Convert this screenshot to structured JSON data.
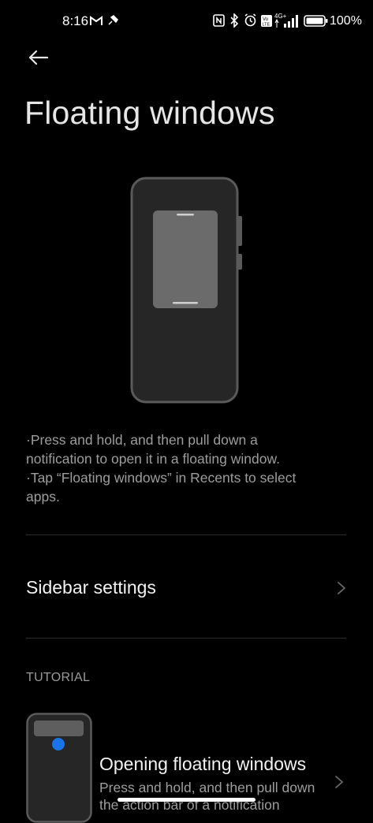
{
  "status_bar": {
    "time": "8:16",
    "battery_percent": "100%",
    "icons": [
      "gmail-icon",
      "pin-icon",
      "nfc-icon",
      "bluetooth-icon",
      "alarm-icon",
      "volte-icon",
      "signal-4g-icon",
      "battery-icon"
    ],
    "network_label": "4G+"
  },
  "header": {
    "back_icon": "arrow-left-icon",
    "title": "Floating windows"
  },
  "description": {
    "line1": "·Press and hold, and then pull down a",
    "line2": "notification to open it in a floating window.",
    "line3": "·Tap “Floating windows” in Recents to select",
    "line4": "apps."
  },
  "settings": {
    "sidebar_label": "Sidebar settings"
  },
  "tutorial": {
    "section_label": "TUTORIAL",
    "items": [
      {
        "title": "Opening floating windows",
        "desc_line1": "Press and hold, and then pull down",
        "desc_line2": "the action bar of a notification"
      }
    ]
  },
  "colors": {
    "background": "#000000",
    "text_primary": "#f2f2f2",
    "text_secondary": "#9d9d9d",
    "accent_dot": "#1a73e8"
  }
}
